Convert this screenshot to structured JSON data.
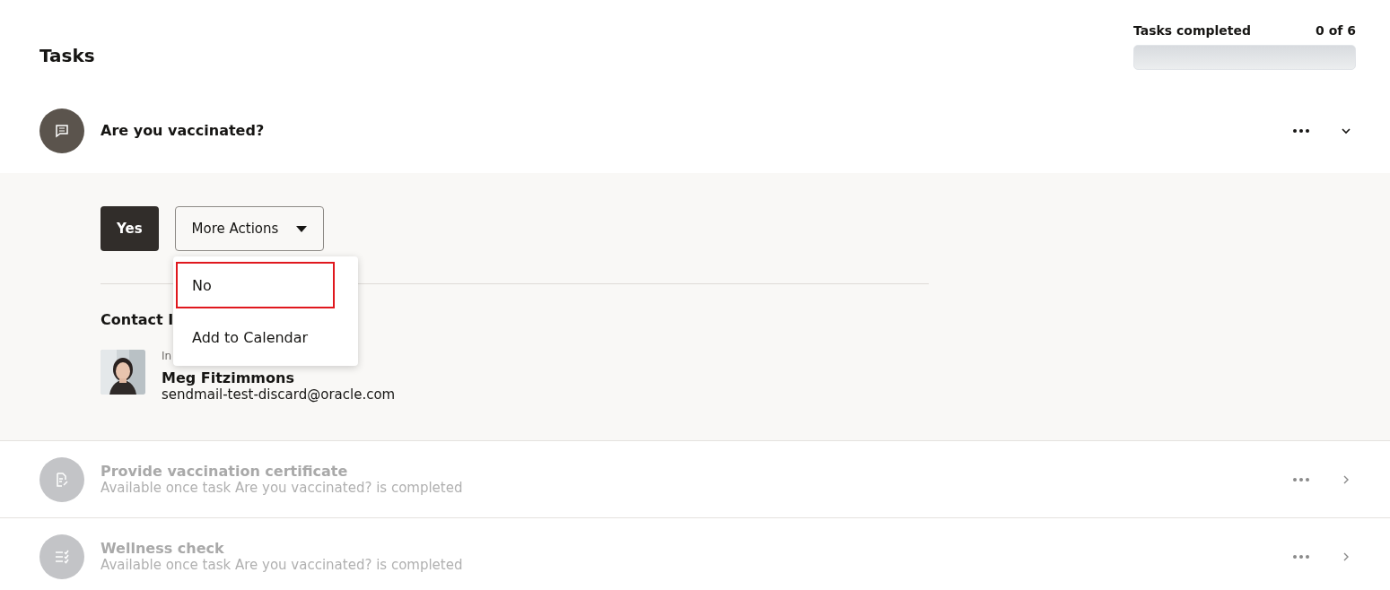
{
  "title": "Tasks",
  "progress": {
    "label": "Tasks completed",
    "count": "0 of 6",
    "level": 0
  },
  "tasks": [
    {
      "kind": "question",
      "title": "Are you vaccinated?",
      "disabled": false,
      "expanded": true,
      "actions": {
        "primary": "Yes",
        "more": "More Actions",
        "menu": [
          {
            "label": "No",
            "highlighted": true
          },
          {
            "label": "Add to Calendar",
            "highlighted": false
          }
        ]
      },
      "contact": {
        "heading": "Contact I",
        "role": "In",
        "name": "Meg Fitzimmons",
        "email": "sendmail-test-discard@oracle.com"
      }
    },
    {
      "kind": "upload",
      "title": "Provide vaccination certificate",
      "subtitle": "Available once task Are you vaccinated? is completed",
      "disabled": true,
      "expanded": false
    },
    {
      "kind": "form",
      "title": "Wellness check",
      "subtitle": "Available once task Are you vaccinated? is completed",
      "disabled": true,
      "expanded": false
    }
  ]
}
